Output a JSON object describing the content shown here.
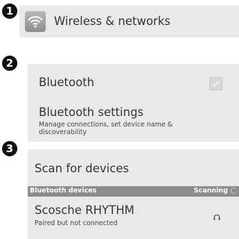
{
  "steps": [
    "1",
    "2",
    "3"
  ],
  "wireless": {
    "icon": "wifi-icon",
    "title": "Wireless & networks"
  },
  "bluetooth": {
    "label": "Bluetooth",
    "enabled": true,
    "settings_title": "Bluetooth settings",
    "settings_subtitle": "Manage connections, set device name & discoverability"
  },
  "scan": {
    "label": "Scan for devices",
    "devices_header": "Bluetooth devices",
    "scanning_label": "Scanning",
    "devices": [
      {
        "name": "Scosche RHYTHM",
        "status": "Paired but not connected",
        "icon": "headphones-icon"
      }
    ]
  }
}
